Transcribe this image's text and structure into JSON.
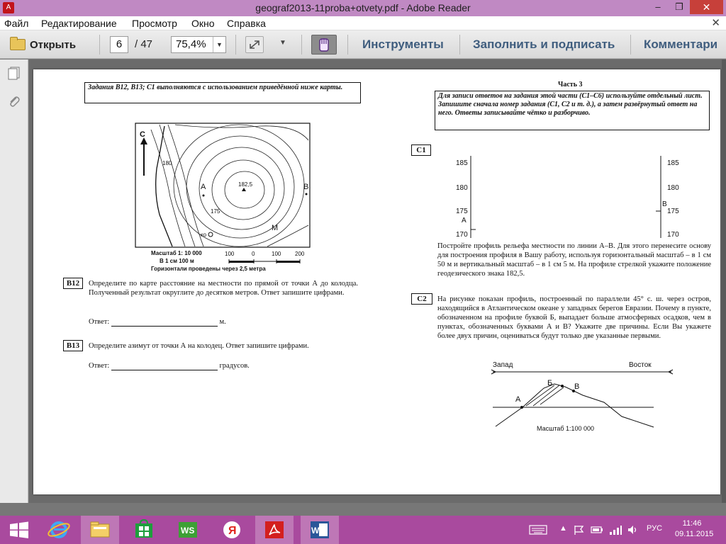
{
  "window": {
    "title": "geograf2013-11proba+otvety.pdf - Adobe Reader",
    "minimize": "–",
    "maximize": "❐",
    "close": "✕"
  },
  "menu": {
    "items": [
      "Файл",
      "Редактирование",
      "Просмотр",
      "Окно",
      "Справка"
    ],
    "close": "✕"
  },
  "toolbar": {
    "open_label": "Открыть",
    "page_current": "6",
    "page_total": "/  47",
    "zoom": "75,4%",
    "tools": "Инструменты",
    "fill_sign": "Заполнить и подписать",
    "comments": "Комментари"
  },
  "doc": {
    "left": {
      "intro": "Задания В12, В13; С1 выполняются с использованием приведённой ниже карты.",
      "map_scale_1": "Масштаб    1: 10 000",
      "map_scale_2": "В 1 см 100 м",
      "map_scale_3": "Горизонтали проведены через 2,5 метра",
      "scale_ticks": [
        "100",
        "0",
        "100",
        "200"
      ],
      "map_labels": {
        "north": "С",
        "a": "А",
        "b": "В",
        "m": "М",
        "peak": "182,5",
        "well": "ко",
        "c1": "175",
        "c2": "180"
      },
      "b12": {
        "tag": "В12",
        "text": "Определите по карте расстояние на местности по прямой от точки А до колодца. Полученный результат округлите до десятков метров. Ответ запишите цифрами.",
        "answer_label": "Ответ:",
        "unit": "м."
      },
      "b13": {
        "tag": "В13",
        "text": "Определите азимут от точки А на колодец. Ответ запишите цифрами.",
        "answer_label": "Ответ:",
        "unit": "градусов."
      }
    },
    "right": {
      "part": "Часть 3",
      "part_note": "Для записи ответов на задания этой части (С1–С6) используйте отдельный лист. Запишите сначала номер задания (С1, С2 и т. д.), а затем развёрнутый ответ на него. Ответы записывайте чётко и разборчиво.",
      "c1": {
        "tag": "С1",
        "axis_ticks": [
          "185",
          "180",
          "175",
          "170"
        ],
        "label_a": "А",
        "label_b": "В",
        "text": "Постройте профиль рельефа местности по линии А–В. Для этого перенесите основу для построения профиля в Вашу работу, используя горизонтальный масштаб – в 1 см 50 м и вертикальный масштаб – в 1 см 5 м. На профиле стрелкой укажите положение геодезического знака 182,5."
      },
      "c2": {
        "tag": "С2",
        "text": "На рисунке показан профиль, построенный по параллели 45° с. ш. через остров, находящийся в Атлантическом океане у западных берегов Евразии. Почему в пункте, обозначенном на профиле буквой Б, выпадает больше атмосферных осадков, чем в пунктах, обозначенных буквами А и В? Укажите две причины. Если Вы укажете более двух причин, оцениваться будут только две указанные первыми.",
        "west": "Запад",
        "east": "Восток",
        "pt_a": "А",
        "pt_b": "Б",
        "pt_v": "В",
        "scale": "Масштаб  1:100 000"
      }
    }
  },
  "taskbar": {
    "lang": "РУС",
    "time": "11:46",
    "date": "09.11.2015"
  }
}
